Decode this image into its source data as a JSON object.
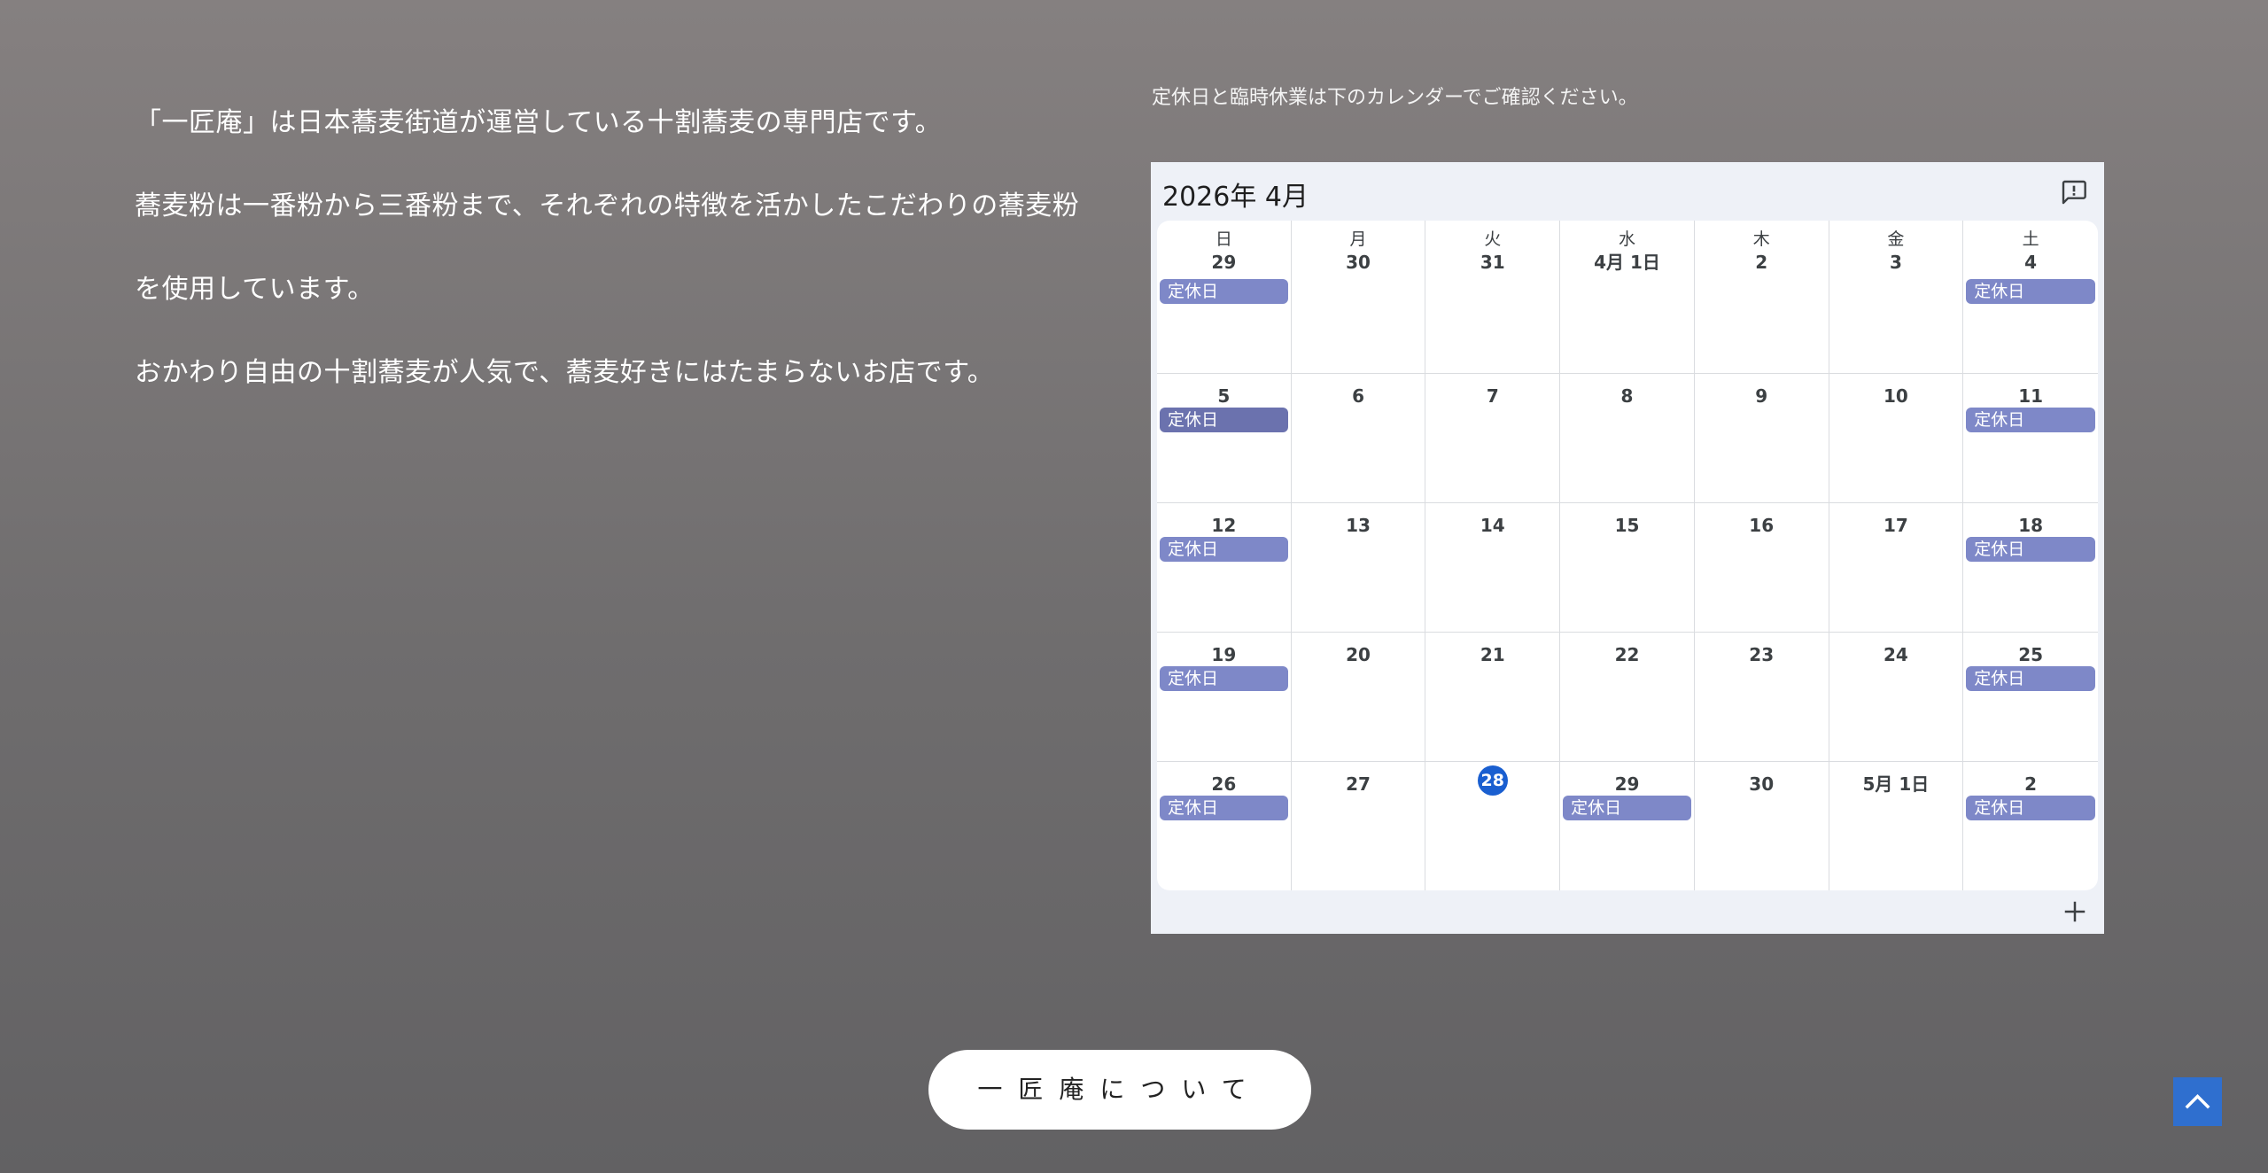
{
  "intro": {
    "lines": [
      "「一匠庵」は日本蕎麦街道が運営している十割蕎麦の専門店です。",
      "蕎麦粉は一番粉から三番粉まで、それぞれの特徴を活かしたこだわりの蕎麦粉",
      "を使用しています。",
      "おかわり自由の十割蕎麦が人気で、蕎麦好きにはたまらないお店です。"
    ]
  },
  "calendar_note": "定休日と臨時休業は下のカレンダーでご確認ください。",
  "calendar": {
    "title": "2026年 4月",
    "weekdays": [
      "日",
      "月",
      "火",
      "水",
      "木",
      "金",
      "土"
    ],
    "event_label": "定休日",
    "event_color": "#7e88c8",
    "today_color": "#1a5fd0",
    "weeks": [
      [
        "29",
        "30",
        "31",
        "4月 1日",
        "2",
        "3",
        "4"
      ],
      [
        "5",
        "6",
        "7",
        "8",
        "9",
        "10",
        "11"
      ],
      [
        "12",
        "13",
        "14",
        "15",
        "16",
        "17",
        "18"
      ],
      [
        "19",
        "20",
        "21",
        "22",
        "23",
        "24",
        "25"
      ],
      [
        "26",
        "27",
        "28",
        "29",
        "30",
        "5月 1日",
        "2"
      ]
    ],
    "events": [
      [
        true,
        false,
        false,
        false,
        false,
        false,
        true
      ],
      [
        true,
        false,
        false,
        false,
        false,
        false,
        true
      ],
      [
        true,
        false,
        false,
        false,
        false,
        false,
        true
      ],
      [
        true,
        false,
        false,
        false,
        false,
        false,
        true
      ],
      [
        true,
        false,
        false,
        true,
        false,
        false,
        true
      ]
    ],
    "today": {
      "week": 4,
      "day": 2
    },
    "icons": {
      "feedback": "feedback-icon",
      "add": "plus-icon"
    }
  },
  "about_button": "一匠庵について",
  "to_top_icon": "chevron-up-icon",
  "colors": {
    "accent": "#2f6fcf"
  }
}
